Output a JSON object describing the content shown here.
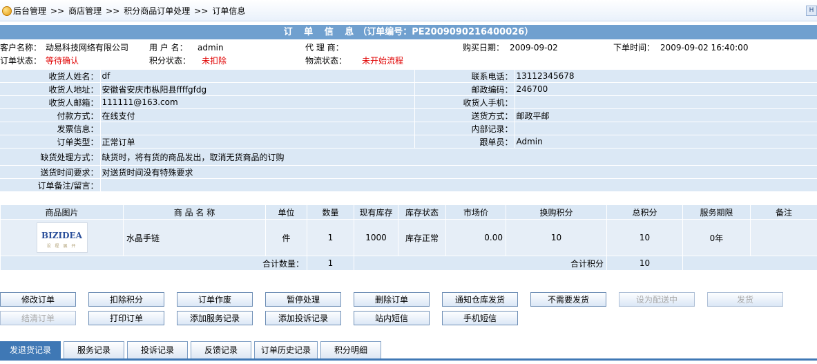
{
  "breadcrumb": {
    "items": [
      "后台管理",
      "商店管理",
      "积分商品订单处理",
      "订单信息"
    ],
    "sep": ">>"
  },
  "top_right_label": "H",
  "order_title": {
    "label": "订 单 信 息",
    "code_text": "（订单编号：PE2009090216400026）"
  },
  "info": {
    "customer_label": "客户名称：",
    "customer": "动易科技网络有限公司",
    "user_label": "用 户 名：",
    "user": "admin",
    "agent_label": "代 理 商：",
    "agent": "",
    "buy_date_label": "购买日期：",
    "buy_date": "2009-09-02",
    "order_time_label": "下单时间：",
    "order_time": "2009-09-02 16:40:00",
    "order_status_label": "订单状态：",
    "order_status": "等待确认",
    "points_status_label": "积分状态：",
    "points_status": "未扣除",
    "logistics_label": "物流状态：",
    "logistics": "未开始流程"
  },
  "details": {
    "receiver_name_label": "收货人姓名：",
    "receiver_name": "df",
    "phone_label": "联系电话：",
    "phone": "13112345678",
    "address_label": "收货人地址：",
    "address": "安徽省安庆市枞阳县ffffgfdg",
    "zip_label": "邮政编码：",
    "zip": "246700",
    "email_label": "收货人邮箱：",
    "email": "111111@163.com",
    "mobile_label": "收货人手机：",
    "mobile": "",
    "pay_label": "付款方式：",
    "pay": "在线支付",
    "ship_label": "送货方式：",
    "ship": "邮政平邮",
    "invoice_label": "发票信息：",
    "invoice": "",
    "internal_label": "内部记录：",
    "internal": "",
    "type_label": "订单类型：",
    "type": "正常订单",
    "follow_label": "跟单员：",
    "follow": "Admin",
    "shortage_label": "缺货处理方式：",
    "shortage": "缺货时，将有货的商品发出，取消无货商品的订购",
    "time_req_label": "送货时间要求：",
    "time_req": "对送货时间没有特殊要求",
    "remark_label": "订单备注/留言：",
    "remark": ""
  },
  "items_table": {
    "headers": [
      "商品图片",
      "商 品 名 称",
      "单位",
      "数量",
      "现有库存",
      "库存状态",
      "市场价",
      "换购积分",
      "总积分",
      "服务期限",
      "备注"
    ],
    "rows": [
      {
        "logo_main": "BIZIDEA",
        "logo_sub": "设 程 展 开",
        "name": "水晶手链",
        "unit": "件",
        "qty": "1",
        "stock": "1000",
        "stock_status": "库存正常",
        "market_price": "0.00",
        "points": "10",
        "total_points": "10",
        "service": "0年",
        "note": ""
      }
    ],
    "sum_qty_label": "合计数量：",
    "sum_qty": "1",
    "sum_points_label": "合计积分",
    "sum_points": "10"
  },
  "buttons_row1": [
    {
      "label": "修改订单",
      "enabled": true
    },
    {
      "label": "扣除积分",
      "enabled": true
    },
    {
      "label": "订单作废",
      "enabled": true
    },
    {
      "label": "暂停处理",
      "enabled": true
    },
    {
      "label": "删除订单",
      "enabled": true
    },
    {
      "label": "通知仓库发货",
      "enabled": true
    },
    {
      "label": "不需要发货",
      "enabled": true
    },
    {
      "label": "设为配送中",
      "enabled": false
    },
    {
      "label": "发货",
      "enabled": false
    }
  ],
  "buttons_row2": [
    {
      "label": "结清订单",
      "enabled": false
    },
    {
      "label": "打印订单",
      "enabled": true
    },
    {
      "label": "添加服务记录",
      "enabled": true
    },
    {
      "label": "添加投诉记录",
      "enabled": true
    },
    {
      "label": "站内短信",
      "enabled": true
    },
    {
      "label": "手机短信",
      "enabled": true
    }
  ],
  "tabs": [
    {
      "label": "发退货记录",
      "active": true
    },
    {
      "label": "服务记录",
      "active": false
    },
    {
      "label": "投诉记录",
      "active": false
    },
    {
      "label": "反馈记录",
      "active": false
    },
    {
      "label": "订单历史记录",
      "active": false
    },
    {
      "label": "积分明细",
      "active": false
    }
  ]
}
